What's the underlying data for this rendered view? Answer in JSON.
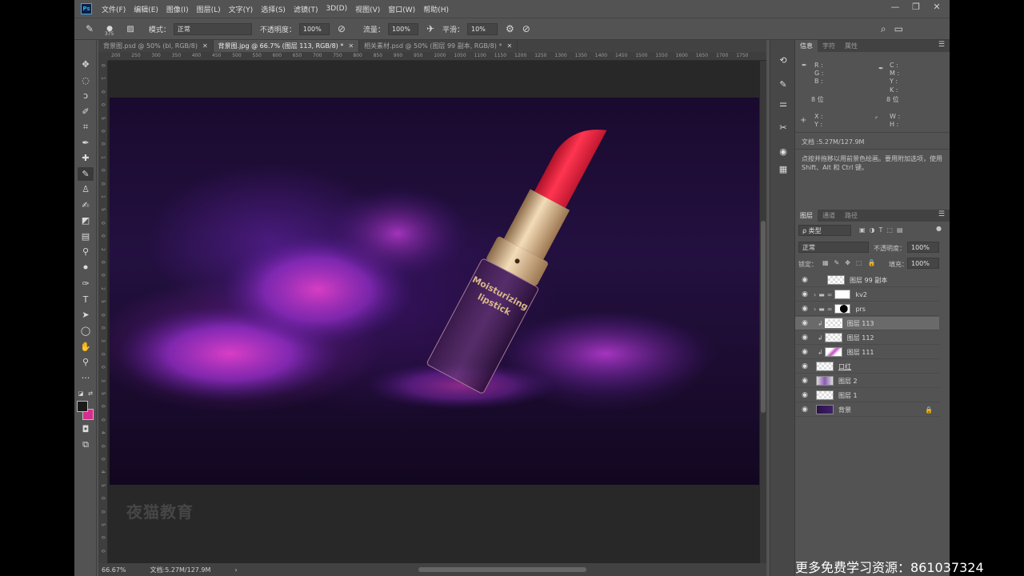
{
  "menubar": {
    "logo": "Ps",
    "items": [
      "文件(F)",
      "编辑(E)",
      "图像(I)",
      "图层(L)",
      "文字(Y)",
      "选择(S)",
      "滤镜(T)",
      "3D(D)",
      "视图(V)",
      "窗口(W)",
      "帮助(H)"
    ],
    "minimize": "—",
    "restore": "❐",
    "close": "✕"
  },
  "options": {
    "brush_size": "375",
    "mode_label": "模式：",
    "mode_value": "正常",
    "opacity_label": "不透明度：",
    "opacity_value": "100%",
    "flow_label": "流量：",
    "flow_value": "100%",
    "smooth_label": "平滑：",
    "smooth_value": "10%"
  },
  "doc_tabs": [
    {
      "label": "背景图.psd @ 50% (bl, RGB/8)",
      "close": "✕"
    },
    {
      "label": "背景图.jpg @ 66.7% (图层 113, RGB/8) *",
      "close": "✕"
    },
    {
      "label": "相关素材.psd @ 50% (图层 99 副本, RGB/8) *",
      "close": "✕"
    }
  ],
  "ruler_top": [
    "200",
    "250",
    "300",
    "350",
    "400",
    "450",
    "500",
    "550",
    "600",
    "650",
    "700",
    "750",
    "800",
    "850",
    "900",
    "950",
    "1000",
    "1050",
    "1100",
    "1150",
    "1200",
    "1250",
    "1300",
    "1350",
    "1400",
    "1450",
    "1500",
    "1550",
    "1600",
    "1650",
    "1700",
    "1750"
  ],
  "ruler_left": [
    "0",
    "1",
    "0",
    "0",
    "5",
    "0",
    "0",
    "1",
    "0",
    "0",
    "1",
    "5",
    "0",
    "0",
    "2",
    "0",
    "0",
    "2",
    "5",
    "0",
    "0",
    "3",
    "0",
    "0",
    "3",
    "5",
    "0",
    "0",
    "4",
    "0",
    "0",
    "4",
    "5",
    "0",
    "0",
    "5",
    "0",
    "0"
  ],
  "product": {
    "line1": "Moisturizing",
    "line2": "lipstick"
  },
  "watermark": "夜猫教育",
  "status": {
    "zoom": "66.67%",
    "doc": "文档:5.27M/127.9M",
    "arrow": "›"
  },
  "info_panel": {
    "tabs": [
      "信息",
      "字符",
      "属性"
    ],
    "r": "R :",
    "g": "G :",
    "b": "B :",
    "bits_left": "8 位",
    "c": "C :",
    "m": "M :",
    "y": "Y :",
    "k": "K :",
    "bits_right": "8 位",
    "x": "X :",
    "y2": "Y :",
    "w": "W :",
    "h": "H :",
    "doc": "文档 :5.27M/127.9M",
    "hint": "点按并拖移以用前景色绘画。要用附加选项，使用 Shift、Alt 和 Ctrl 键。"
  },
  "layers_panel": {
    "tabs": [
      "图层",
      "通道",
      "路径"
    ],
    "filter": "ρ 类型",
    "blend": "正常",
    "opacity_label": "不透明度：",
    "opacity_value": "100%",
    "lock_label": "锁定：",
    "fill_label": "填充：",
    "fill_value": "100%",
    "layers": [
      {
        "name": "图层 99 副本"
      },
      {
        "name": "kv2"
      },
      {
        "name": "prs"
      },
      {
        "name": "图层 113"
      },
      {
        "name": "图层 112"
      },
      {
        "name": "图层 111"
      },
      {
        "name": "口红"
      },
      {
        "name": "图层 2"
      },
      {
        "name": "图层 1"
      },
      {
        "name": "背景"
      }
    ]
  },
  "footer": "更多免费学习资源：861037324",
  "colors": {
    "foreground": "#1a1a1a",
    "background": "#d62d8f",
    "lipstick": "#e8243a",
    "gold": "#d9b98a"
  }
}
